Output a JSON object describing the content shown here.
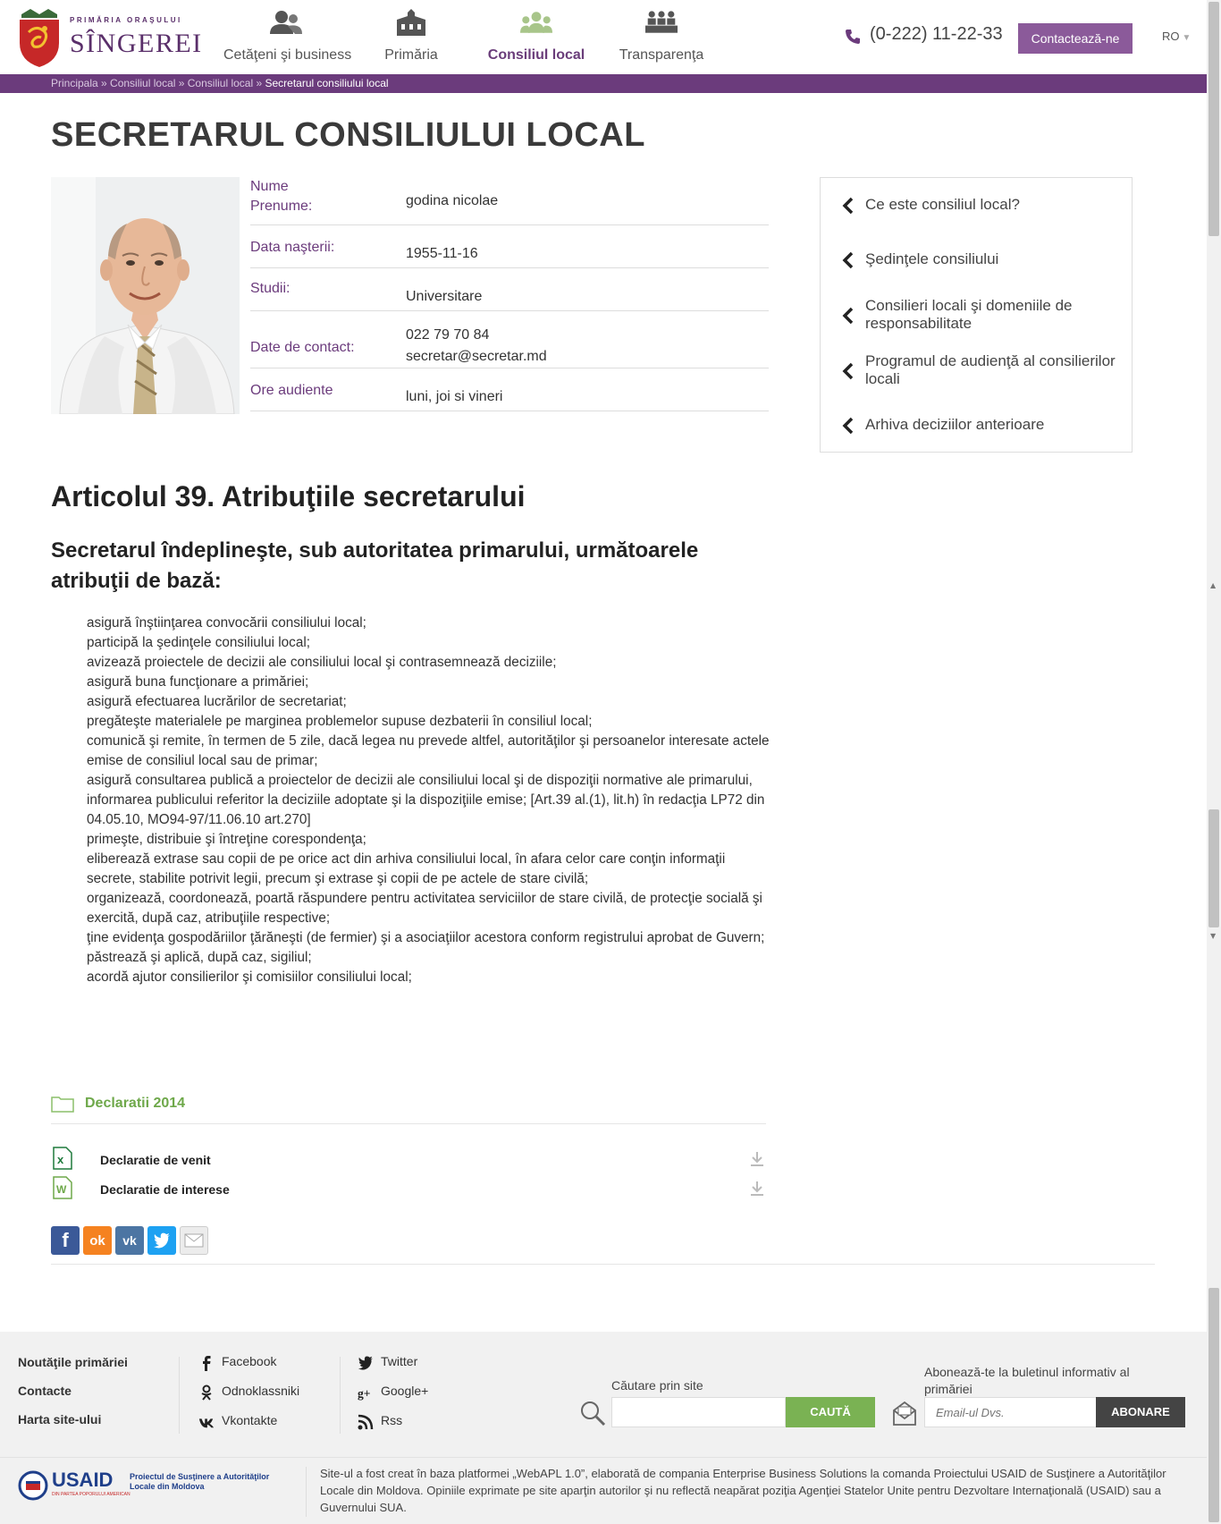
{
  "header": {
    "logo_top": "PRIMĂRIA ORAŞULUI",
    "logo_city": "SÎNGEREI",
    "nav": [
      {
        "label": "Cetăţeni şi business",
        "icon": "users-icon"
      },
      {
        "label": "Primăria",
        "icon": "building-icon"
      },
      {
        "label": "Consiliul local",
        "icon": "council-icon",
        "active": true
      },
      {
        "label": "Transparenţa",
        "icon": "meeting-icon"
      }
    ],
    "phone": "(0-222) 11-22-33",
    "contact_label": "Contactează-ne",
    "lang": "RO"
  },
  "breadcrumb": {
    "items": [
      "Principala",
      "Consiliul local",
      "Consiliul local"
    ],
    "sep": " » ",
    "current": "Secretarul consiliului local"
  },
  "page_title": "SECRETARUL CONSILIULUI LOCAL",
  "profile": [
    {
      "key": "Nume\nPrenume:",
      "value": "godina nicolae"
    },
    {
      "key": "Data naşterii:",
      "value": "1955-11-16"
    },
    {
      "key": "Studii:",
      "value": "Universitare"
    },
    {
      "key": "Date de contact:",
      "value": "022 79 70 84\nsecretar@secretar.md"
    },
    {
      "key": "Ore audiente",
      "value": "luni, joi si vineri"
    }
  ],
  "sidebar": [
    "Ce este consiliul local?",
    "Şedinţele consiliului",
    "Consilieri locali şi domeniile de responsabilitate",
    "Programul de audienţă al consilierilor locali",
    "Arhiva deciziilor anterioare"
  ],
  "article": {
    "heading": "Articolul 39. Atribuţiile secretarului",
    "subheading": "Secretarul îndeplineşte, sub autoritatea primarului, următoarele atribuţii de bază:",
    "items": [
      "asigură înştiinţarea convocării consiliului local;",
      "participă la şedinţele consiliului local;",
      "avizează proiectele de decizii ale consiliului local şi contrasemnează deciziile;",
      "asigură buna funcţionare a primăriei;",
      "asigură efectuarea lucrărilor de secretariat;",
      "pregăteşte materialele pe marginea problemelor supuse dezbaterii în consiliul local;",
      "comunică şi remite, în termen de 5 zile, dacă legea nu prevede altfel, autorităţilor şi persoanelor interesate actele emise de consiliul local sau de primar;",
      "asigură consultarea publică a proiectelor de decizii ale consiliului local şi de dispoziţii normative ale primarului, informarea publicului referitor la deciziile adoptate şi la dispoziţiile emise; [Art.39 al.(1), lit.h) în redacţia LP72 din 04.05.10,  MO94-97/11.06.10 art.270]",
      "primeşte, distribuie şi întreţine corespondenţa;",
      "eliberează extrase sau copii de pe orice act din arhiva consiliului local, în afara celor care conţin informaţii secrete, stabilite potrivit legii, precum şi extrase şi copii de pe actele de stare civilă;",
      "organizează, coordonează, poartă răspundere pentru activitatea serviciilor de stare civilă, de protecţie socială şi exercită, după caz, atribuţiile respective;",
      "ţine evidenţa gospodăriilor ţărăneşti (de fermier) şi a asociaţiilor acestora conform registrului aprobat de Guvern;",
      "păstrează şi aplică, după caz, sigiliul;",
      "acordă ajutor consilierilor şi comisiilor consiliului local;"
    ]
  },
  "declarations": {
    "folder": "Declaratii 2014",
    "files": [
      {
        "name": "Declaratie de venit",
        "icon": "excel-file-icon",
        "color": "#1f7a3c"
      },
      {
        "name": "Declaratie de interese",
        "icon": "word-file-icon",
        "color": "#6ea84a"
      }
    ]
  },
  "share": [
    {
      "name": "facebook-share-button",
      "glyph": "f",
      "color": "#3b5998"
    },
    {
      "name": "odnoklassniki-share-button",
      "glyph": "ok",
      "color": "#f58220"
    },
    {
      "name": "vkontakte-share-button",
      "glyph": "vk",
      "color": "#4c75a3"
    },
    {
      "name": "twitter-share-button",
      "glyph": "t",
      "color": "#1da1f2"
    },
    {
      "name": "email-share-button",
      "glyph": "✉",
      "color": "#e8e8e8"
    }
  ],
  "footer": {
    "links": [
      "Noutăţile primăriei",
      "Contacte",
      "Harta site-ului"
    ],
    "social_left": [
      {
        "label": "Facebook",
        "icon": "facebook-icon"
      },
      {
        "label": "Odnoklassniki",
        "icon": "odnoklassniki-icon"
      },
      {
        "label": "Vkontakte",
        "icon": "vkontakte-icon"
      }
    ],
    "social_right": [
      {
        "label": "Twitter",
        "icon": "twitter-icon"
      },
      {
        "label": "Google+",
        "icon": "google-plus-icon"
      },
      {
        "label": "Rss",
        "icon": "rss-icon"
      }
    ],
    "search_label": "Căutare prin site",
    "search_button": "CAUTĂ",
    "subscribe_label": "Abonează-te la buletinul informativ al primăriei",
    "subscribe_placeholder": "Email-ul Dvs.",
    "subscribe_button": "ABONARE"
  },
  "credits": {
    "usaid": "USAID",
    "usaid_sub": "DIN PARTEA POPORULUI AMERICAN",
    "project": "Proiectul de Susţinere a Autorităţilor Locale din Moldova",
    "text": "Site-ul a fost creat în baza platformei „WebAPL 1.0”, elaborată de compania Enterprise Business Solutions la comanda Proiectului USAID de Susţinere a Autorităţilor Locale din Moldova. Opiniile exprimate pe site aparţin autorilor şi nu reflectă neapărat poziţia Agenţiei Statelor Unite pentru Dezvoltare Internaţională (USAID) sau a Guvernului SUA."
  }
}
